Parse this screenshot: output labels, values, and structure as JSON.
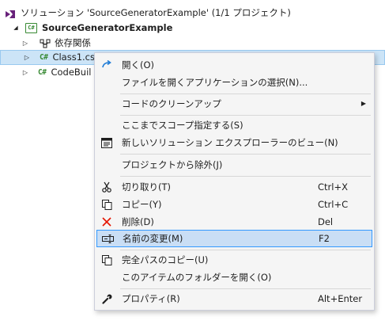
{
  "solution_explorer": {
    "solution_label": "ソリューション 'SourceGeneratorExample' (1/1 プロジェクト)",
    "project_label": "SourceGeneratorExample",
    "dependencies_label": "依存関係",
    "file1_label": "Class1.cs",
    "file2_label": "CodeBuil",
    "cs_badge": "C#",
    "project_badge": "C#"
  },
  "context_menu": {
    "open": "開く(O)",
    "open_with": "ファイルを開くアプリケーションの選択(N)...",
    "code_cleanup": "コードのクリーンアップ",
    "scope_to_this": "ここまでスコープ指定する(S)",
    "new_explorer_view": "新しいソリューション エクスプローラーのビュー(N)",
    "exclude_from_project": "プロジェクトから除外(J)",
    "cut": "切り取り(T)",
    "cut_shortcut": "Ctrl+X",
    "copy": "コピー(Y)",
    "copy_shortcut": "Ctrl+C",
    "delete": "削除(D)",
    "delete_shortcut": "Del",
    "rename": "名前の変更(M)",
    "rename_shortcut": "F2",
    "copy_full_path": "完全パスのコピー(U)",
    "open_containing_folder": "このアイテムのフォルダーを開く(O)",
    "properties": "プロパティ(R)",
    "properties_shortcut": "Alt+Enter"
  },
  "colors": {
    "selection": "#cce4f7",
    "menu_highlight": "#c9def5",
    "cs_green": "#388a34",
    "delete_red": "#e51400",
    "open_blue": "#1e7bd6"
  },
  "icons": {
    "solution": "solution-icon",
    "project": "csharp-project-icon",
    "dependencies": "dependencies-icon",
    "open": "open-arrow-icon",
    "new_view": "solution-explorer-view-icon",
    "cut": "scissors-icon",
    "copy": "copy-icon",
    "delete": "delete-x-icon",
    "rename": "rename-icon",
    "copy_path": "copy-path-icon",
    "properties": "wrench-icon",
    "submenu": "chevron-right-icon"
  }
}
